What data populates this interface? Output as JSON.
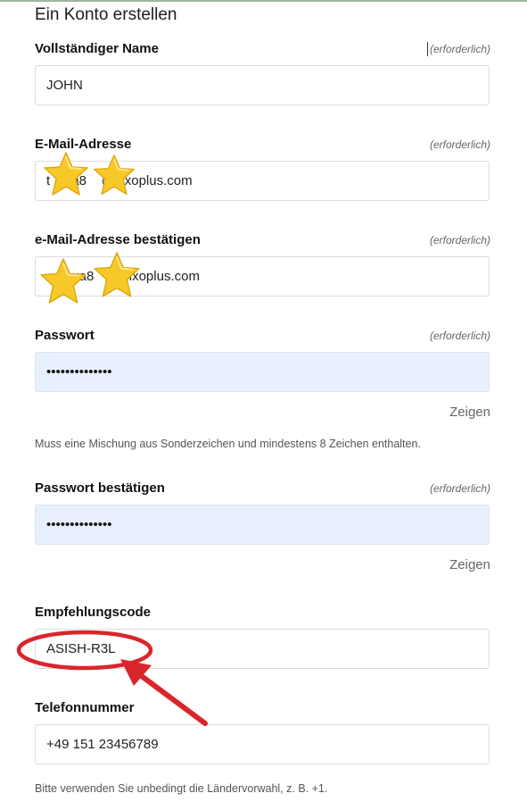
{
  "form": {
    "title": "Ein Konto erstellen",
    "required_text": "(erforderlich)",
    "show_label": "Zeigen",
    "full_name": {
      "label": "Vollständiger Name",
      "value": "JOHN"
    },
    "email": {
      "label": "E-Mail-Adresse",
      "value": "t    ya8    @sixoplus.com"
    },
    "email_confirm": {
      "label": "e-Mail-Adresse bestätigen",
      "value": "       ya8    @sixoplus.com"
    },
    "password": {
      "label": "Passwort",
      "value": "••••••••••••••",
      "hint": "Muss eine Mischung aus Sonderzeichen und mindestens 8 Zeichen enthalten."
    },
    "password_confirm": {
      "label": "Passwort bestätigen",
      "value": "••••••••••••••"
    },
    "referral": {
      "label": "Empfehlungscode",
      "value": "ASISH-R3L"
    },
    "phone": {
      "label": "Telefonnummer",
      "value": "+49 151 23456789",
      "hint": "Bitte verwenden Sie unbedingt die Ländervorwahl, z. B. +1."
    }
  },
  "colors": {
    "autofill_bg": "#e8f0fe",
    "annotation_red": "#d9262b",
    "star_yellow": "#f7c928"
  },
  "icons": [
    "star-emoji-icon",
    "highlight-ellipse",
    "pointer-arrow"
  ]
}
